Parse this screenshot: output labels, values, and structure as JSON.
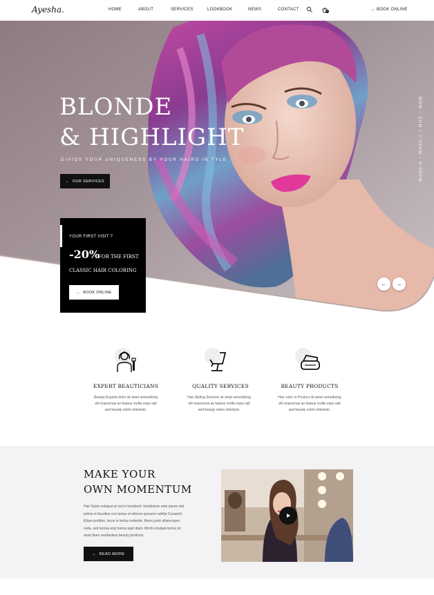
{
  "brand": {
    "logo": "Ayesha."
  },
  "nav": {
    "items": [
      "HOME",
      "ABOUT",
      "SERVICES",
      "LOOKBOOK",
      "NEWS",
      "CONTACT"
    ],
    "cart_count": "0",
    "book_label": "BOOK ONLINE"
  },
  "hero": {
    "title_line1": "BLONDE",
    "title_line2": "& HIGHLIGHT",
    "subtitle": "DIVIDS YOUR UNIQUENESS BY YOUR HAIRS IN TYLE",
    "button_label": "OUR SERVICES",
    "side_text": "MON - SUN / 7:00AM - 8:00PM"
  },
  "promo": {
    "question": "YOUR FIRST VISIT ?",
    "discount": "-20%",
    "for_text": "FOR THE FIRST",
    "service": "CLASSIC HAIR COLORING",
    "button_label": "BOOK ONLINE"
  },
  "features": [
    {
      "icon": "beautician-icon",
      "title": "EXPERT BEAUTICIANS",
      "desc1": "Beauty Experts dolor sit amet semodicing",
      "desc2": "elit maecenas as faubus mollis expo sall",
      "desc3": "and beauty exten interdum."
    },
    {
      "icon": "salon-chair-icon",
      "title": "QUALITY SERVICES",
      "desc1": "Hair Styling Services sit amet semodicing",
      "desc2": "elit maecenas as faubus mollis expo sall",
      "desc3": "and beauty exten interdum."
    },
    {
      "icon": "cosmetics-icon",
      "title": "BEAUTY PRODUCTS",
      "desc1": "Hair color or Product sit amet semodicing",
      "desc2": "elit maecenas as faubus mollis expo sall",
      "desc3": "and beauty exten interdum."
    }
  ],
  "momentum": {
    "title_line1": "MAKE YOUR",
    "title_line2": "OWN MOMENTUM",
    "lines": [
      "Hair Salon volutpat ut nisl in hendrerit. Vestibulum ante ipsum nisl",
      "primis in faucibus orci luctus et ultrices posuere cubilia Curaemil",
      "Etiam porttitor, lacus in lectus molestie, libero justo ullamcorper",
      "nulla, sed lacinia erat metus eget diam. Morbi volutpat lectus sit",
      "amet diam vestibulass beauty products"
    ],
    "button_label": "READ MORE"
  },
  "colors": {
    "accent": "#111111",
    "panel_bg": "#f3f3f5"
  }
}
